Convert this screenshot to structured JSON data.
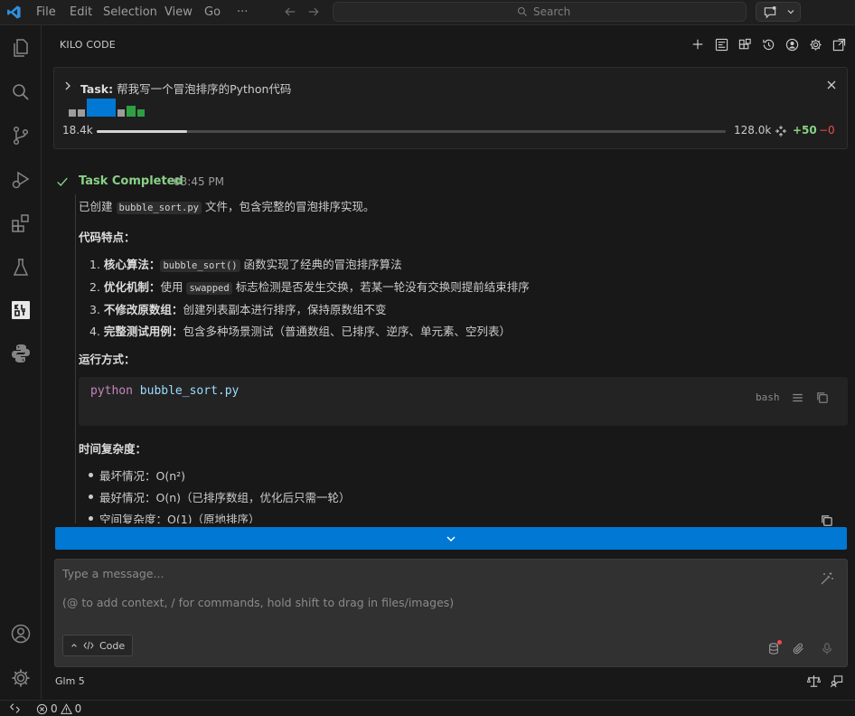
{
  "titlebar": {
    "menus": [
      "File",
      "Edit",
      "Selection",
      "View",
      "Go",
      "···"
    ],
    "search_placeholder": "Search"
  },
  "activity_bar": {
    "icons": [
      "files-icon",
      "search-icon",
      "source-control-icon",
      "run-debug-icon",
      "extensions-icon",
      "testing-icon",
      "kilo-code-icon",
      "python-icon",
      "account-icon",
      "settings-gear-icon"
    ]
  },
  "panel": {
    "title": "KILO CODE",
    "header_icons": [
      "plus-icon",
      "mcp-icon",
      "modes-icon",
      "history-icon",
      "profile-icon",
      "settings-icon",
      "popout-icon"
    ]
  },
  "task": {
    "label": "Task:",
    "title": "帮我写一个冒泡排序的Python代码",
    "tokens_used": "18.4k",
    "tokens_max": "128.0k",
    "progress_fraction": 0.144,
    "lines_added": "+50",
    "lines_removed": "−0"
  },
  "message": {
    "status": "Task Completed",
    "time": "03:45 PM",
    "intro_prefix": "已创建",
    "intro_file": "bubble_sort.py",
    "intro_suffix": "文件，包含完整的冒泡排序实现。",
    "features_heading": "代码特点：",
    "features": [
      {
        "num": "1.",
        "title": "核心算法：",
        "code": "bubble_sort()",
        "text": "函数实现了经典的冒泡排序算法"
      },
      {
        "num": "2.",
        "title": "优化机制：",
        "pre": "使用",
        "code": "swapped",
        "text": "标志检测是否发生交换，若某一轮没有交换则提前结束排序"
      },
      {
        "num": "3.",
        "title": "不修改原数组：",
        "text": "创建列表副本进行排序，保持原数组不变"
      },
      {
        "num": "4.",
        "title": "完整测试用例：",
        "text": "包含多种场景测试（普通数组、已排序、逆序、单元素、空列表）"
      }
    ],
    "run_heading": "运行方式：",
    "code_cmd": "python",
    "code_arg": "bubble_sort.py",
    "code_lang": "bash",
    "complexity_heading": "时间复杂度：",
    "complexity": [
      "最坏情况：O(n²)",
      "最好情况：O(n)（已排序数组，优化后只需一轮）",
      "空间复杂度：O(1)（原地排序）"
    ]
  },
  "input": {
    "placeholder_line1": "Type a message...",
    "placeholder_line2": "(@ to add context, / for commands, hold shift to drag in files/images)",
    "mode": "Code"
  },
  "model": "Glm 5",
  "statusbar": {
    "errors": "0",
    "warnings": "0"
  },
  "colors": {
    "accent": "#0078d4",
    "success": "#89d185",
    "danger": "#f14c4c"
  }
}
